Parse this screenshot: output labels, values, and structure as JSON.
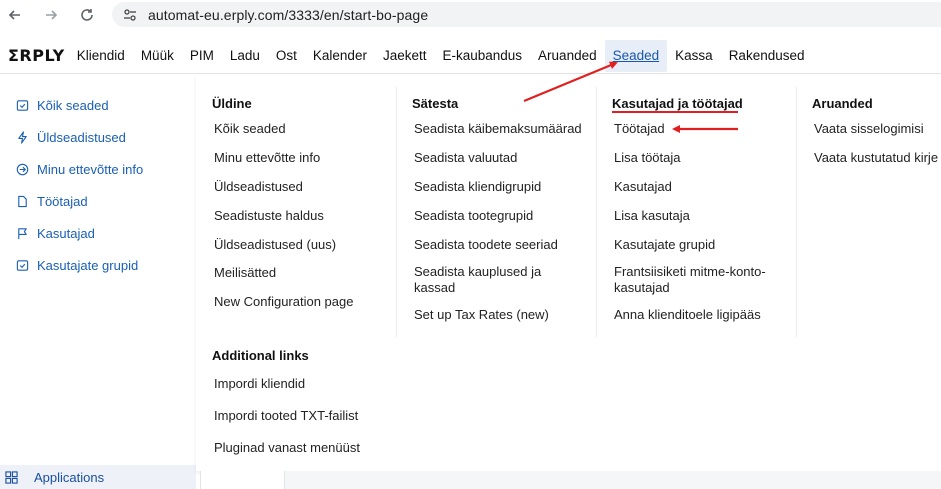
{
  "browser": {
    "url": "automat-eu.erply.com/3333/en/start-bo-page",
    "back_icon": "arrow-left-icon",
    "forward_icon": "arrow-right-icon",
    "reload_icon": "reload-icon",
    "site_info_icon": "tune-icon"
  },
  "topnav": {
    "logo": "ΣRPLY",
    "items": [
      {
        "label": "Kliendid"
      },
      {
        "label": "Müük"
      },
      {
        "label": "PIM"
      },
      {
        "label": "Ladu"
      },
      {
        "label": "Ost"
      },
      {
        "label": "Kalender"
      },
      {
        "label": "Jaekett"
      },
      {
        "label": "E-kaubandus"
      },
      {
        "label": "Aruanded"
      },
      {
        "label": "Seaded",
        "active": true
      },
      {
        "label": "Kassa"
      },
      {
        "label": "Rakendused"
      }
    ]
  },
  "sidebar": {
    "items": [
      {
        "label": "Kõik seaded",
        "icon": "check-calendar-icon"
      },
      {
        "label": "Üldseadistused",
        "icon": "lightning-icon"
      },
      {
        "label": "Minu ettevõtte info",
        "icon": "arrow-circle-icon"
      },
      {
        "label": "Töötajad",
        "icon": "document-icon"
      },
      {
        "label": "Kasutajad",
        "icon": "flag-icon"
      },
      {
        "label": "Kasutajate grupid",
        "icon": "check-calendar-icon"
      }
    ],
    "bottom": {
      "label": "Applications",
      "icon": "grid-icon"
    }
  },
  "mega": {
    "col1": {
      "title": "Üldine",
      "links": [
        "Kõik seaded",
        "Minu ettevõtte info",
        "Üldseadistused",
        "Seadistuste haldus",
        "Üldseadistused (uus)",
        "Meilisätted",
        "New Configuration page"
      ]
    },
    "col1b": {
      "title": "Additional links",
      "links": [
        "Impordi kliendid",
        "Impordi tooted TXT-failist",
        "Pluginad vanast menüüst"
      ]
    },
    "col2": {
      "title": "Sätesta",
      "links": [
        "Seadista käibemaksumäärad",
        "Seadista valuutad",
        "Seadista kliendigrupid",
        "Seadista tootegrupid",
        "Seadista toodete seeriad",
        "Seadista kauplused ja kassad",
        "Set up Tax Rates (new)"
      ]
    },
    "col3": {
      "title": "Kasutajad ja töötajad",
      "links": [
        "Töötajad",
        "Lisa töötaja",
        "Kasutajad",
        "Lisa kasutaja",
        "Kasutajate grupid",
        "Frantsiisiketi mitme-konto-kasutajad",
        "Anna klienditoele ligipääs"
      ]
    },
    "col4": {
      "title": "Aruanded",
      "links": [
        "Vaata sisselogimisi",
        "Vaata kustutatud kirje"
      ]
    }
  },
  "colors": {
    "accent": "#1a5fb4",
    "active_bg": "#e8eef7",
    "annotation": "#e02020"
  }
}
